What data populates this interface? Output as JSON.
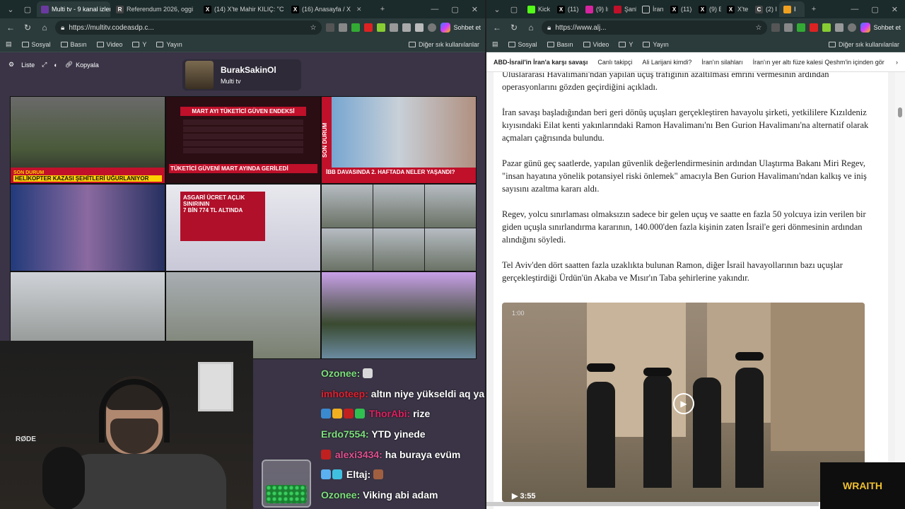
{
  "left_window": {
    "tabs": [
      {
        "label": "Multi tv - 9 kanal izlenir",
        "active": true,
        "color": "#6a3aa0"
      },
      {
        "label": "Referendum 2026, oggi",
        "active": false,
        "color": "#222222"
      },
      {
        "label": "(14) X'te Mahir KILIÇ: \"C",
        "active": false,
        "color": "#000000"
      },
      {
        "label": "(16) Anasayfa / X",
        "active": false,
        "color": "#000000"
      }
    ],
    "address": "https://multitv.codeasdp.c...",
    "copilot_label": "Sohbet et",
    "bookmarks": [
      "Sosyal",
      "Basın",
      "Video",
      "Y",
      "Yayın"
    ],
    "bookmarks_right": "Diğer sık kullanılanlar"
  },
  "multitv": {
    "tools": {
      "list": "Liste",
      "copy": "Kopyala"
    },
    "profile": {
      "name": "BurakSakinOl",
      "sub": "Multi tv"
    },
    "cells": {
      "c1_ticker": "HELİKOPTER KAZASI ŞEHİTLERİ UĞURLANIYOR",
      "c1_top": "SON DURUM",
      "c2_title": "MART AYI TÜKETİCİ GÜVEN ENDEKSİ",
      "c2_bottom": "TÜKETİCİ GÜVENİ MART AYINDA GERİLEDİ",
      "c3_vert": "SON DURUM",
      "c3_ticker": "İBB DAVASINDA 2. HAFTADA NELER YAŞANDI?",
      "c5_title": "ASGARİ ÜCRET AÇLIK SINIRININ",
      "c5_sub": "7 BİN 774 TL ALTINDA"
    }
  },
  "chat": [
    {
      "user": "Ozonee:",
      "text": "",
      "color": "#7de07d"
    },
    {
      "user": "imhoteep:",
      "text": "altın niye yükseldi aq ya",
      "color": "#e02030"
    },
    {
      "user": "ThorAbi:",
      "text": "rize",
      "color": "#e02060"
    },
    {
      "user": "Erdo7554:",
      "text": "YTD yinede",
      "color": "#7de07d"
    },
    {
      "user": "alexi3434:",
      "text": "ha buraya evüm",
      "color": "#e05090"
    },
    {
      "user": "Eltaj:",
      "text": "",
      "color": "#ffffff"
    },
    {
      "user": "Ozonee:",
      "text": "Viking abi adam",
      "color": "#7de07d"
    }
  ],
  "right_window": {
    "tabs": [
      {
        "label": "Kick",
        "color": "#53fc18"
      },
      {
        "label": "(11)",
        "color": "#000000"
      },
      {
        "label": "(9) In",
        "color": "#d6249f"
      },
      {
        "label": "Şanlı",
        "color": "#c0102a"
      },
      {
        "label": "İran",
        "color": "#2a2a2a"
      },
      {
        "label": "(11)",
        "color": "#000000"
      },
      {
        "label": "(9) B",
        "color": "#000000"
      },
      {
        "label": "X'te",
        "color": "#000000"
      },
      {
        "label": "(2) I",
        "color": "#444444"
      },
      {
        "label": "I",
        "color": "#f0a020"
      }
    ],
    "address": "https://www.alj...",
    "copilot_label": "Sohbet et",
    "bookmarks": [
      "Sosyal",
      "Basın",
      "Video",
      "Y",
      "Yayın"
    ],
    "bookmarks_right": "Diğer sık kullanılanlar"
  },
  "article": {
    "nav": [
      "ABD-İsrail'in İran'a karşı savaşı",
      "Canlı takipçi",
      "Ali Larijani kimdi?",
      "İran'ın silahları",
      "İran'ın yer altı füze kalesi Qeshm'in içinden gör"
    ],
    "partial_top": "Uluslararası Havalimanı'ndan yapılan uçuş trafiğinin azaltılması emrini vermesinin ardından operasyonlarını gözden geçirdiğini açıkladı.",
    "p1": "İran savaşı başladığından beri geri dönüş uçuşları gerçekleştiren havayolu şirketi, yetkililere Kızıldeniz kıyısındaki Eilat kenti yakınlarındaki Ramon Havalimanı'nı Ben Gurion Havalimanı'na alternatif olarak açmaları çağrısında bulundu.",
    "p2": "Pazar günü geç saatlerde, yapılan güvenlik değerlendirmesinin ardından Ulaştırma Bakanı Miri Regev, \"insan hayatına yönelik potansiyel riski önlemek\" amacıyla Ben Gurion Havalimanı'ndan kalkış ve iniş sayısını azaltma kararı aldı.",
    "p3": "Regev, yolcu sınırlaması olmaksızın sadece bir gelen uçuş ve saatte en fazla 50 yolcuya izin verilen bir giden uçuşla sınırlandırma kararının, 140.000'den fazla kişinin zaten İsrail'e geri dönmesinin ardından alındığını söyledi.",
    "p4": "Tel Aviv'den dört saatten fazla uzaklıkta bulunan Ramon, diğer İsrail havayollarının bazı uçuşlar gerçekleştirdiği Ürdün'ün Akaba ve Mısır'ın Taba şehirlerine yakındır.",
    "video_timecode": "1:00",
    "video_duration": "3:55"
  },
  "overlay": {
    "wraith": "WRAITH",
    "mic_brand": "RØDE"
  }
}
